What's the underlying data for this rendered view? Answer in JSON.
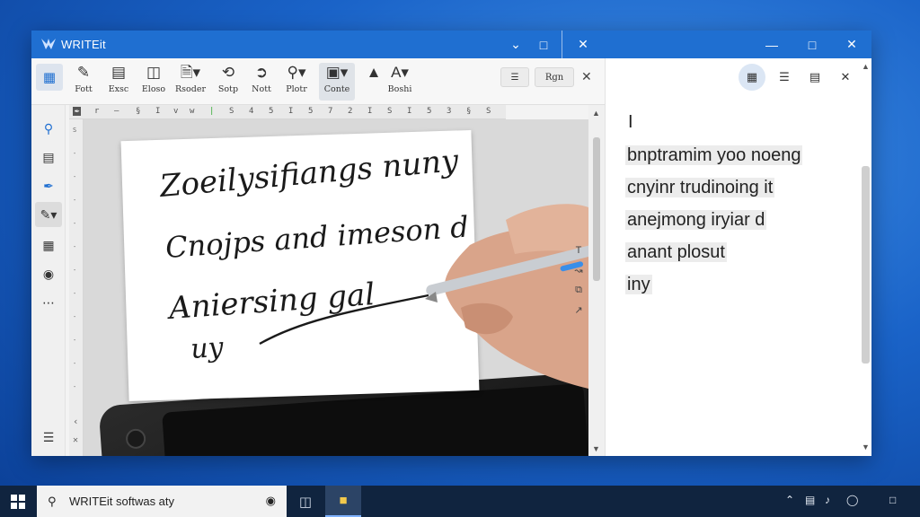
{
  "app": {
    "title": "WRITEit",
    "accent": "#1f6fd1"
  },
  "titlebar": {
    "left_buttons": [
      "chevron-down-icon",
      "maximize-icon"
    ],
    "close_symbol": "✕",
    "right_buttons": [
      "minimize-icon",
      "maximize-icon",
      "close-icon"
    ]
  },
  "ribbon": {
    "items": [
      {
        "icon": "pen-icon",
        "label": "Fott"
      },
      {
        "icon": "layout-icon",
        "label": "Exsc"
      },
      {
        "icon": "columns-icon",
        "label": "Eloso"
      },
      {
        "icon": "document-icon",
        "label": "Rsoder"
      },
      {
        "icon": "lasso-icon",
        "label": "Sotp"
      },
      {
        "icon": "text-icon",
        "label": "Nott"
      },
      {
        "icon": "search-icon",
        "label": "Plotr"
      },
      {
        "icon": "shape-icon",
        "label": "Conte"
      },
      {
        "icon": "arrow-up-icon",
        "label": ""
      },
      {
        "icon": "font-icon",
        "label": "Boshi"
      }
    ],
    "pills": [
      "☰",
      "Rgn"
    ],
    "close": "✕"
  },
  "ruler_marks": [
    "r",
    "–",
    "§",
    "I",
    "v",
    "w",
    "S",
    "4",
    "5",
    "I",
    "5",
    "7",
    "2",
    "I",
    "S",
    "I",
    "5",
    "3",
    "§",
    "S",
    "3",
    "3",
    "–"
  ],
  "handwriting": {
    "lines": [
      "Zoeilysifiangs nuny",
      "Cnojps and imeson d",
      "Aniersing gal",
      "uy"
    ]
  },
  "recognized": {
    "cursor": "I",
    "lines": [
      "bnptramim yoo noeng",
      "cnyinr trudinoing it",
      "anejmong iryiar d",
      "anant plosut",
      "iny"
    ]
  },
  "taskbar": {
    "search_text": "WRITEit softwas aty",
    "search_icon": "search-icon"
  }
}
